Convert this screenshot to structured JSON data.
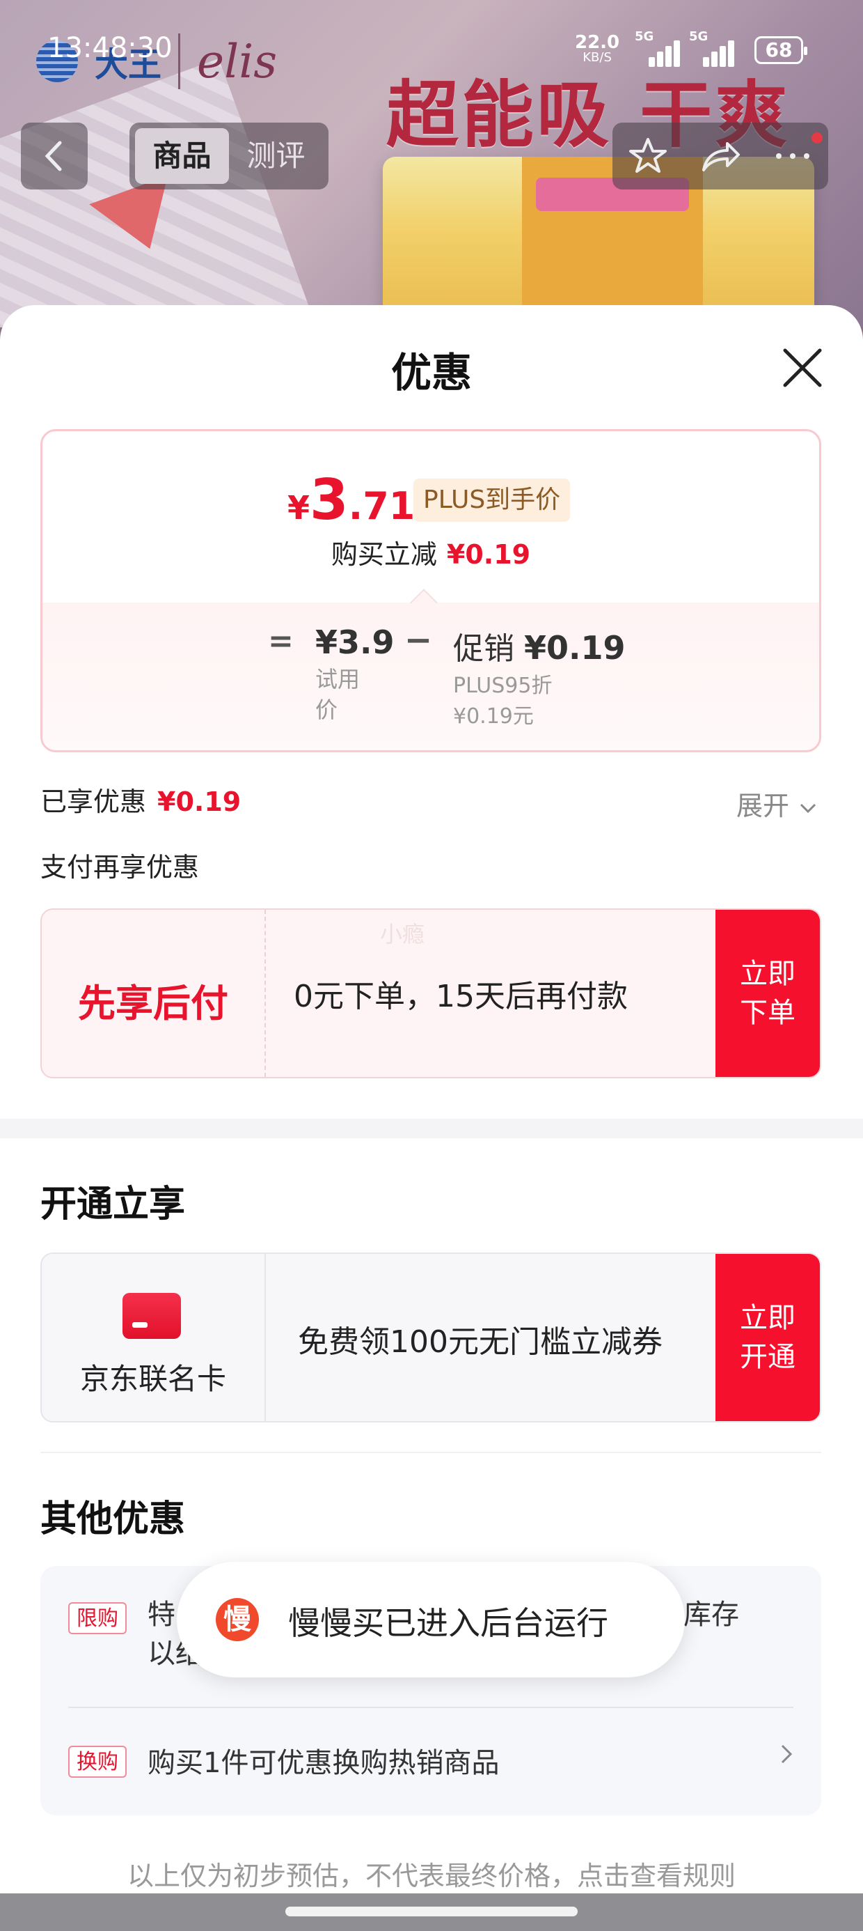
{
  "status_bar": {
    "time": "13:48:30",
    "net_speed": "22.0",
    "net_unit": "KB/S",
    "sig1_label": "5G",
    "sig2_label": "5G",
    "battery": "68"
  },
  "hero": {
    "brand": "大王",
    "brand2": "elis",
    "slogan": "超能吸 干爽"
  },
  "nav": {
    "tabs": [
      {
        "label": "商品",
        "active": true
      },
      {
        "label": "测评",
        "active": false
      }
    ],
    "icons": [
      "back-icon",
      "star-icon",
      "share-icon",
      "more-icon"
    ]
  },
  "sheet": {
    "title": "优惠",
    "price": {
      "yen": "¥",
      "int": "3",
      "dec": ".71",
      "plus_tag": "PLUS到手价",
      "reduce_label": "购买立减",
      "reduce_value": "¥0.19",
      "eq": "=",
      "base_value": "¥3.9",
      "base_label": "试用价",
      "minus": "−",
      "promo_prefix": "促销",
      "promo_value": "¥0.19",
      "promo_line1": "PLUS95折",
      "promo_line2": "¥0.19元"
    },
    "enjoyed_label": "已享优惠",
    "enjoyed_value": "¥0.19",
    "expand_label": "展开",
    "pay_more_label": "支付再享优惠",
    "pay_later": {
      "title": "先享后付",
      "text": "0元下单，15天后再付款",
      "watermark": "小瘾",
      "button": "立即下单"
    },
    "open_title": "开通立享",
    "card_offer": {
      "label": "京东联名卡",
      "text": "免费领100元无门槛立减券",
      "button": "立即开通"
    },
    "other_title": "其他优惠",
    "other": [
      {
        "tag": "限购",
        "text": "特…………………………………库存以结…"
      },
      {
        "tag": "换购",
        "text": "购买1件可优惠换购热销商品"
      }
    ],
    "row1_visible_left": "特",
    "row1_visible_left2": "以结",
    "row1_visible_right": "库存",
    "footer_note": "以上仅为初步预估，不代表最终价格，点击查看规则"
  },
  "toast": {
    "icon_char": "慢",
    "text": "慢慢买已进入后台运行"
  },
  "colors": {
    "accent_red": "#e8132c",
    "button_red": "#f5102e"
  }
}
